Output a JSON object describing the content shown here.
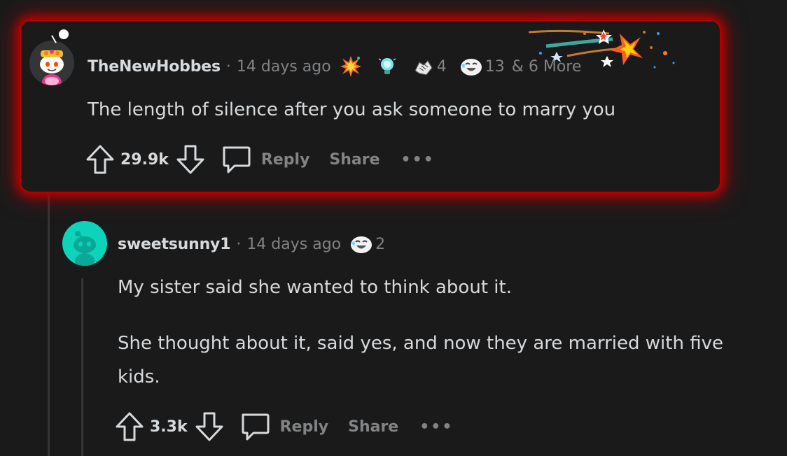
{
  "comments": [
    {
      "username": "TheNewHobbes",
      "time": "14 days ago",
      "awards": [
        {
          "icon": "explosion-award-icon",
          "count": ""
        },
        {
          "icon": "lightbulb-award-icon",
          "count": ""
        },
        {
          "icon": "handshake-award-icon",
          "count": "4"
        },
        {
          "icon": "laughing-face-award-icon",
          "count": "13"
        }
      ],
      "more_awards": "& 6 More",
      "body": "The length of silence after you ask someone to marry you",
      "score": "29.9k",
      "reply_label": "Reply",
      "share_label": "Share",
      "overflow_label": "•••"
    },
    {
      "username": "sweetsunny1",
      "time": "14 days ago",
      "awards": [
        {
          "icon": "laughing-face-award-icon",
          "count": "2"
        }
      ],
      "body_paragraphs": [
        "My sister said she wanted to think about it.",
        "She thought about it, said yes, and now they are married with five kids."
      ],
      "score": "3.3k",
      "reply_label": "Reply",
      "share_label": "Share",
      "overflow_label": "•••"
    }
  ],
  "colors": {
    "highlight_glow": "#c00000",
    "background": "#1a1a1b",
    "text": "#d7dadc",
    "muted": "#818384",
    "thread_line": "#343536",
    "avatar_teal": "#0dd3bb"
  }
}
